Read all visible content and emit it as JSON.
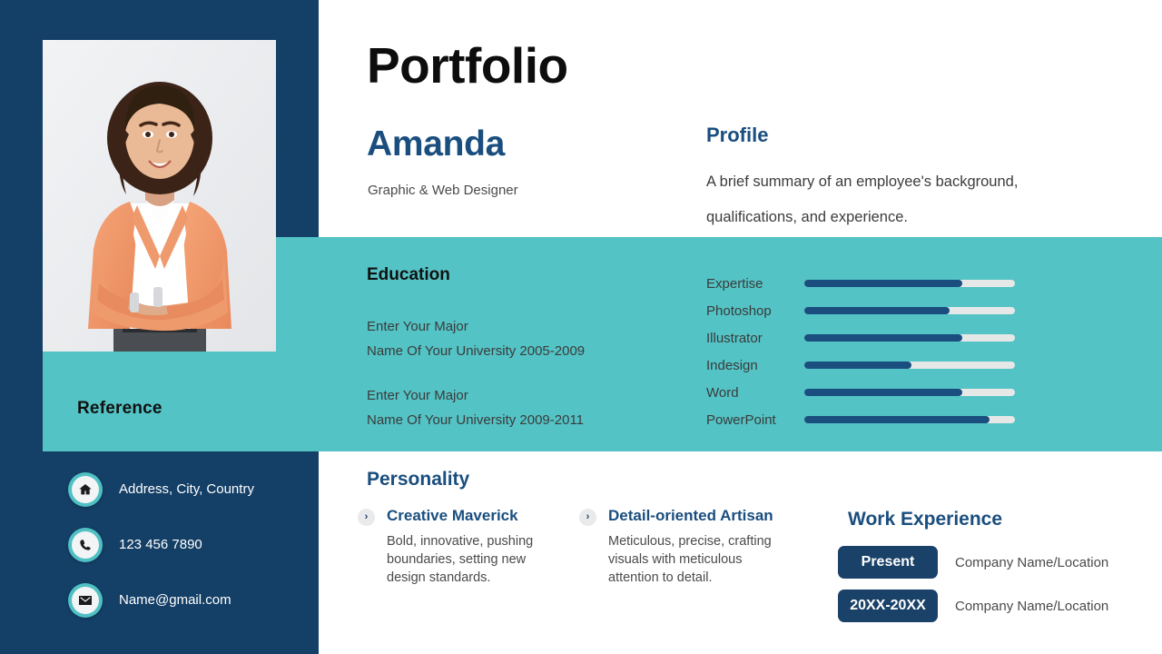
{
  "theme": {
    "navy": "#143f66",
    "teal": "#53c3c5",
    "accent_blue": "#1a4e7e",
    "badge_navy": "#1a4168",
    "track_gray": "#e6e8e8"
  },
  "header": {
    "title": "Portfolio",
    "name": "Amanda",
    "role": "Graphic & Web Designer"
  },
  "profile": {
    "heading": "Profile",
    "text": "A brief summary of an employee's background, qualifications, and experience."
  },
  "education": {
    "heading": "Education",
    "entries": [
      {
        "major": "Enter Your Major",
        "university": "Name Of Your University 2005-2009"
      },
      {
        "major": "Enter Your Major",
        "university": "Name Of Your University 2009-2011"
      }
    ]
  },
  "skills": {
    "items": [
      {
        "label": "Expertise",
        "value": 75
      },
      {
        "label": "Photoshop",
        "value": 69
      },
      {
        "label": "Illustrator",
        "value": 75
      },
      {
        "label": "Indesign",
        "value": 51
      },
      {
        "label": "Word",
        "value": 75
      },
      {
        "label": "PowerPoint",
        "value": 88
      }
    ]
  },
  "personality": {
    "heading": "Personality",
    "bullet_glyph": "›",
    "items": [
      {
        "title": "Creative Maverick",
        "description": "Bold, innovative, pushing boundaries, setting new design standards."
      },
      {
        "title": "Detail-oriented Artisan",
        "description": "Meticulous, precise, crafting visuals with meticulous attention to detail."
      }
    ]
  },
  "work_experience": {
    "heading": "Work Experience",
    "entries": [
      {
        "period": "Present",
        "company": "Company Name/Location"
      },
      {
        "period": "20XX-20XX",
        "company": "Company Name/Location"
      }
    ]
  },
  "sidebar": {
    "reference_title": "Reference",
    "contacts": [
      {
        "icon": "home-icon",
        "text": "Address, City, Country"
      },
      {
        "icon": "phone-icon",
        "text": "123 456 7890"
      },
      {
        "icon": "mail-icon",
        "text": "Name@gmail.com"
      }
    ]
  }
}
